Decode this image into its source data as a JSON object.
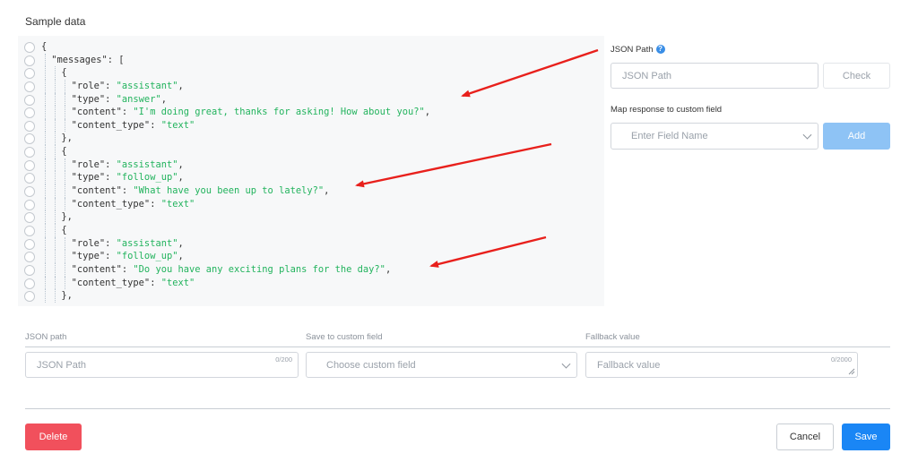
{
  "sample_section": {
    "title": "Sample data"
  },
  "code": {
    "lines": [
      {
        "indent": 0,
        "parts": [
          {
            "t": "{",
            "c": "k"
          }
        ]
      },
      {
        "indent": 1,
        "parts": [
          {
            "t": "\"messages\"",
            "c": "k"
          },
          {
            "t": ": [",
            "c": "k"
          }
        ]
      },
      {
        "indent": 2,
        "parts": [
          {
            "t": "{",
            "c": "k"
          }
        ]
      },
      {
        "indent": 3,
        "parts": [
          {
            "t": "\"role\"",
            "c": "k"
          },
          {
            "t": ": ",
            "c": "k"
          },
          {
            "t": "\"assistant\"",
            "c": "s"
          },
          {
            "t": ",",
            "c": "k"
          }
        ]
      },
      {
        "indent": 3,
        "parts": [
          {
            "t": "\"type\"",
            "c": "k"
          },
          {
            "t": ": ",
            "c": "k"
          },
          {
            "t": "\"answer\"",
            "c": "s"
          },
          {
            "t": ",",
            "c": "k"
          }
        ]
      },
      {
        "indent": 3,
        "parts": [
          {
            "t": "\"content\"",
            "c": "k"
          },
          {
            "t": ": ",
            "c": "k"
          },
          {
            "t": "\"I'm doing great, thanks for asking! How about you?\"",
            "c": "s"
          },
          {
            "t": ",",
            "c": "k"
          }
        ]
      },
      {
        "indent": 3,
        "parts": [
          {
            "t": "\"content_type\"",
            "c": "k"
          },
          {
            "t": ": ",
            "c": "k"
          },
          {
            "t": "\"text\"",
            "c": "s"
          }
        ]
      },
      {
        "indent": 2,
        "parts": [
          {
            "t": "},",
            "c": "k"
          }
        ]
      },
      {
        "indent": 2,
        "parts": [
          {
            "t": "{",
            "c": "k"
          }
        ]
      },
      {
        "indent": 3,
        "parts": [
          {
            "t": "\"role\"",
            "c": "k"
          },
          {
            "t": ": ",
            "c": "k"
          },
          {
            "t": "\"assistant\"",
            "c": "s"
          },
          {
            "t": ",",
            "c": "k"
          }
        ]
      },
      {
        "indent": 3,
        "parts": [
          {
            "t": "\"type\"",
            "c": "k"
          },
          {
            "t": ": ",
            "c": "k"
          },
          {
            "t": "\"follow_up\"",
            "c": "s"
          },
          {
            "t": ",",
            "c": "k"
          }
        ]
      },
      {
        "indent": 3,
        "parts": [
          {
            "t": "\"content\"",
            "c": "k"
          },
          {
            "t": ": ",
            "c": "k"
          },
          {
            "t": "\"What have you been up to lately?\"",
            "c": "s"
          },
          {
            "t": ",",
            "c": "k"
          }
        ]
      },
      {
        "indent": 3,
        "parts": [
          {
            "t": "\"content_type\"",
            "c": "k"
          },
          {
            "t": ": ",
            "c": "k"
          },
          {
            "t": "\"text\"",
            "c": "s"
          }
        ]
      },
      {
        "indent": 2,
        "parts": [
          {
            "t": "},",
            "c": "k"
          }
        ]
      },
      {
        "indent": 2,
        "parts": [
          {
            "t": "{",
            "c": "k"
          }
        ]
      },
      {
        "indent": 3,
        "parts": [
          {
            "t": "\"role\"",
            "c": "k"
          },
          {
            "t": ": ",
            "c": "k"
          },
          {
            "t": "\"assistant\"",
            "c": "s"
          },
          {
            "t": ",",
            "c": "k"
          }
        ]
      },
      {
        "indent": 3,
        "parts": [
          {
            "t": "\"type\"",
            "c": "k"
          },
          {
            "t": ": ",
            "c": "k"
          },
          {
            "t": "\"follow_up\"",
            "c": "s"
          },
          {
            "t": ",",
            "c": "k"
          }
        ]
      },
      {
        "indent": 3,
        "parts": [
          {
            "t": "\"content\"",
            "c": "k"
          },
          {
            "t": ": ",
            "c": "k"
          },
          {
            "t": "\"Do you have any exciting plans for the day?\"",
            "c": "s"
          },
          {
            "t": ",",
            "c": "k"
          }
        ]
      },
      {
        "indent": 3,
        "parts": [
          {
            "t": "\"content_type\"",
            "c": "k"
          },
          {
            "t": ": ",
            "c": "k"
          },
          {
            "t": "\"text\"",
            "c": "s"
          }
        ]
      },
      {
        "indent": 2,
        "parts": [
          {
            "t": "},",
            "c": "k"
          }
        ]
      }
    ],
    "colors": {
      "key": "#333333",
      "string": "#22b35d",
      "background": "#f7f8f9"
    }
  },
  "json_path_panel": {
    "label": "JSON Path",
    "help_icon": "question-circle-icon",
    "input_placeholder": "JSON Path",
    "check_button": "Check",
    "map_label": "Map response to custom field",
    "field_select_placeholder": "Enter Field Name",
    "add_button": "Add"
  },
  "mapping_row": {
    "col_json_path": "JSON path",
    "col_custom_field": "Save to custom field",
    "col_fallback": "Fallback value",
    "json_path_placeholder": "JSON Path",
    "json_path_counter": "0/200",
    "custom_field_placeholder": "Choose custom field",
    "fallback_placeholder": "Fallback value",
    "fallback_counter": "0/2000"
  },
  "footer": {
    "delete_button": "Delete",
    "cancel_button": "Cancel",
    "save_button": "Save"
  },
  "colors": {
    "accent": "#1a86f5",
    "danger": "#f1505c",
    "add_disabled": "#8ec3f5",
    "annotation_arrow": "#e8201c"
  }
}
